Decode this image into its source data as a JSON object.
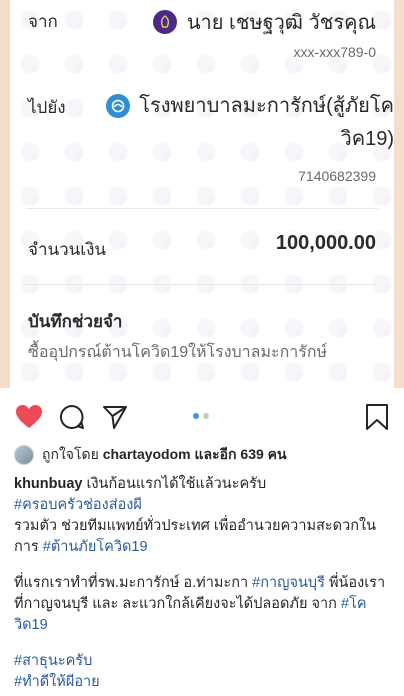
{
  "slip": {
    "from_label": "จาก",
    "sender_name": "นาย เชษฐวุฒิ วัชรคุณ",
    "sender_account": "xxx-xxx789-0",
    "to_label": "ไปยัง",
    "recipient_name": "โรงพยาบาลมะการักษ์(สู้ภัยโควิค19)",
    "recipient_account": "7140682399",
    "amount_label": "จำนวนเงิน",
    "amount": "100,000.00",
    "memo_label": "บันทึกช่วยจำ",
    "memo": "ซื้ออุปกรณ์ต้านโควิด19ให้โรงบาลมะการักษ์"
  },
  "actions": {
    "like_icon": "heart-filled-icon",
    "comment_icon": "comment-icon",
    "share_icon": "send-icon",
    "save_icon": "bookmark-icon",
    "carousel_active_index": 0,
    "carousel_count": 2,
    "like_color": "#ed4956",
    "active_dot_color": "#3897f0",
    "inactive_dot_color": "#c7c7c7"
  },
  "likes": {
    "prefix": "ถูกใจโดย",
    "user": "chartayodom",
    "middle": "และอีก",
    "count": "639 คน"
  },
  "caption": {
    "username": "khunbuay",
    "line1_text": "เงินก้อนแรกได้ใช้แล้วนะครับ",
    "hashtag1": "#ครอบครัวช่องส่องผี",
    "line3_text": "รวมตัว ช่วยทีมแพทย์ทั่วประเทศ เพื่ออำนวยความสะดวกใน",
    "line4_text": "การ",
    "hashtag2": "#ต้านภัยโควิด19",
    "p2_text_a": "ที่แรกเราทำที่รพ.มะการักษ์ อ.ท่ามะกา",
    "hashtag3": "#กาญจนบุรี",
    "p2_text_b": "พี่น้องเรา",
    "p2_line2_text": "ที่กาญจนบุรี และ ละแวกใกล้เคียงจะได้ปลอดภัย จาก",
    "hashtag4_a": "#โค",
    "hashtag4_b": "วิด19",
    "hashtag5": "#สาธุนะครับ",
    "hashtag6": "#ทำดีให้ผีอาย"
  }
}
